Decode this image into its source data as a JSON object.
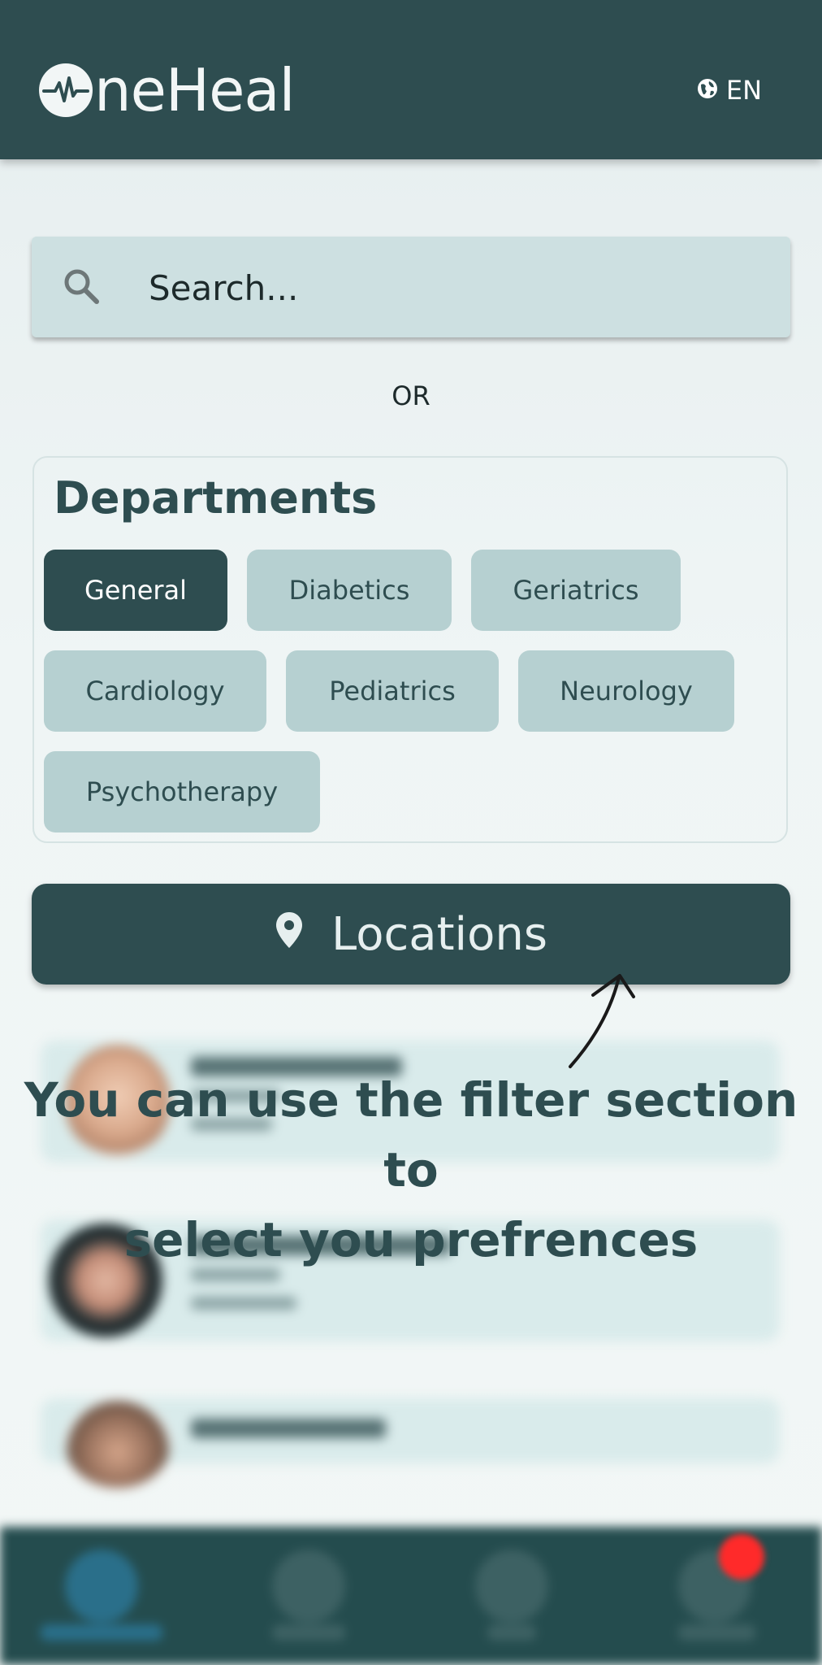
{
  "header": {
    "logo_text": "neHeal",
    "language": "EN"
  },
  "search": {
    "placeholder": "Search..."
  },
  "or_text": "OR",
  "departments": {
    "title": "Departments",
    "chips": [
      {
        "label": "General",
        "active": true
      },
      {
        "label": "Diabetics",
        "active": false
      },
      {
        "label": "Geriatrics",
        "active": false
      },
      {
        "label": "Cardiology",
        "active": false
      },
      {
        "label": "Pediatrics",
        "active": false
      },
      {
        "label": "Neurology",
        "active": false
      },
      {
        "label": "Psychotherapy",
        "active": false
      }
    ]
  },
  "locations": {
    "label": "Locations"
  },
  "hint": {
    "line1": "You can use the filter section to",
    "line2": "select you prefrences"
  },
  "colors": {
    "primary": "#2e4d50",
    "chip": "#b6d0d1",
    "search_bg": "#cde0e1",
    "nav_bg": "#244c4e",
    "badge": "#ff2a2a"
  }
}
